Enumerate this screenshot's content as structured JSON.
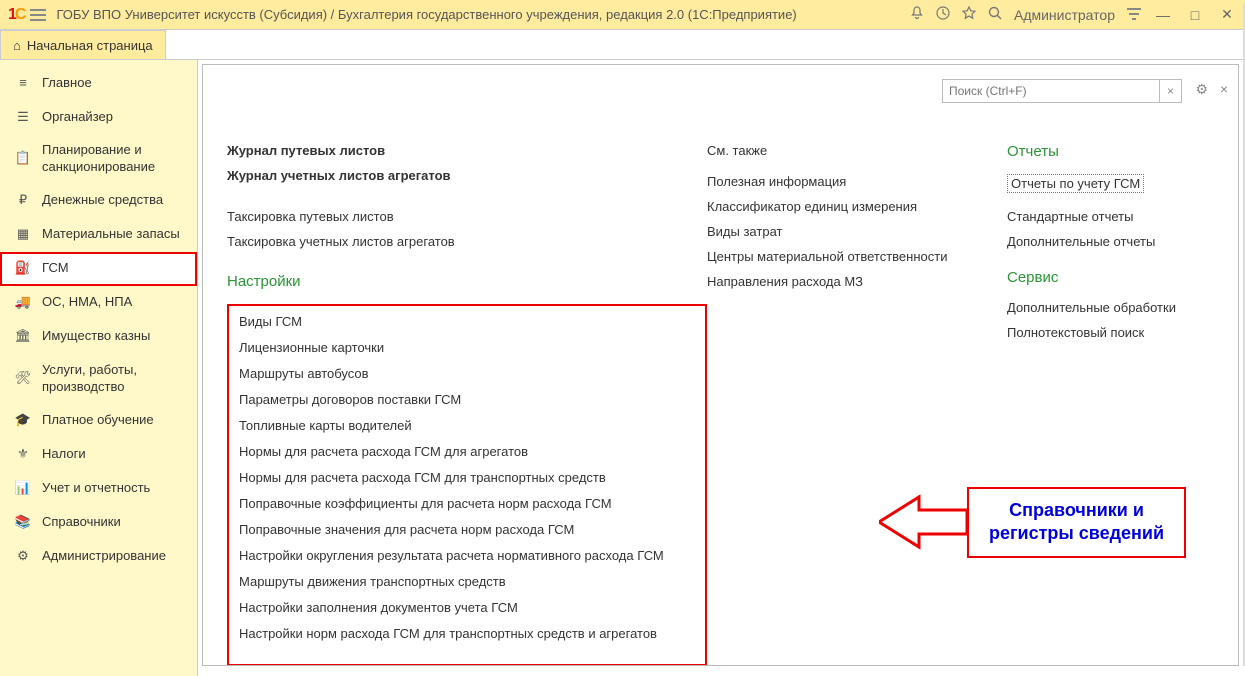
{
  "topbar": {
    "title": "ГОБУ ВПО Университет искусств (Субсидия) / Бухгалтерия государственного учреждения, редакция 2.0  (1С:Предприятие)",
    "user": "Администратор"
  },
  "start_tab": "Начальная страница",
  "sidebar": {
    "items": [
      {
        "label": "Главное"
      },
      {
        "label": "Органайзер"
      },
      {
        "label": "Планирование и санкционирование"
      },
      {
        "label": "Денежные средства"
      },
      {
        "label": "Материальные запасы"
      },
      {
        "label": "ГСМ"
      },
      {
        "label": "ОС, НМА, НПА"
      },
      {
        "label": "Имущество казны"
      },
      {
        "label": "Услуги, работы, производство"
      },
      {
        "label": "Платное обучение"
      },
      {
        "label": "Налоги"
      },
      {
        "label": "Учет и отчетность"
      },
      {
        "label": "Справочники"
      },
      {
        "label": "Администрирование"
      }
    ]
  },
  "search": {
    "placeholder": "Поиск (Ctrl+F)"
  },
  "col1": {
    "top": [
      {
        "label": "Журнал путевых листов",
        "bold": true
      },
      {
        "label": "Журнал учетных листов агрегатов",
        "bold": true
      },
      {
        "label": "Таксировка путевых листов"
      },
      {
        "label": "Таксировка учетных листов агрегатов"
      }
    ],
    "settings_head": "Настройки",
    "settings": [
      "Виды ГСМ",
      "Лицензионные карточки",
      "Маршруты автобусов",
      "Параметры договоров поставки ГСМ",
      "Топливные карты водителей",
      "Нормы для расчета расхода ГСМ для агрегатов",
      "Нормы для расчета расхода ГСМ для транспортных средств",
      "Поправочные коэффициенты для расчета норм расхода ГСМ",
      "Поправочные значения для расчета норм расхода ГСМ",
      "Настройки округления результата расчета нормативного расхода ГСМ",
      "Маршруты движения транспортных средств",
      "Настройки заполнения документов учета ГСМ",
      "Настройки норм расхода ГСМ для транспортных средств и агрегатов"
    ]
  },
  "col2": {
    "head": "См. также",
    "items": [
      "Полезная информация",
      "Классификатор единиц измерения",
      "Виды затрат",
      "Центры материальной ответственности",
      "Направления расхода МЗ"
    ]
  },
  "col3": {
    "reports_head": "Отчеты",
    "reports": [
      "Отчеты по учету ГСМ",
      "Стандартные отчеты",
      "Дополнительные отчеты"
    ],
    "service_head": "Сервис",
    "service": [
      "Дополнительные обработки",
      "Полнотекстовый поиск"
    ]
  },
  "callout": {
    "line1": "Справочники и",
    "line2": "регистры сведений"
  }
}
